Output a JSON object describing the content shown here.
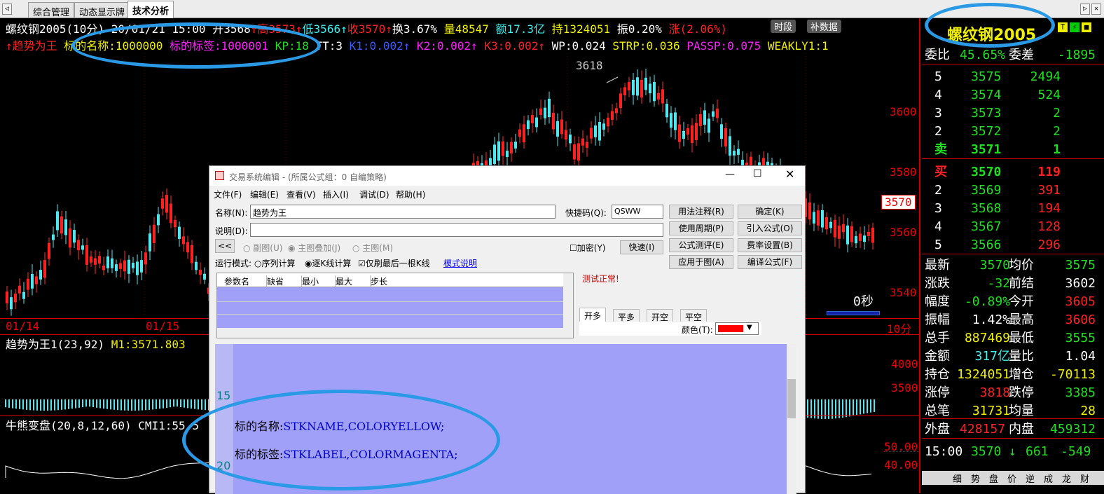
{
  "tabs": {
    "nav_left": "◁",
    "t1": "综合管理",
    "t2": "动态显示牌",
    "t3": "技术分析",
    "nav_right": "▷",
    "close": "✕"
  },
  "header": {
    "line1": [
      {
        "t": "螺纹钢2005(10分) 20/01/21 15:00 开3568",
        "c": "white"
      },
      {
        "t": "↑高3573↑",
        "c": "red"
      },
      {
        "t": "低3566↑",
        "c": "cyan"
      },
      {
        "t": "收3570↑",
        "c": "red"
      },
      {
        "t": "换3.67% ",
        "c": "white"
      },
      {
        "t": "量48547 ",
        "c": "yellow"
      },
      {
        "t": "额17.3亿 ",
        "c": "cyan"
      },
      {
        "t": "持1324051 ",
        "c": "yellow"
      },
      {
        "t": "振0.20% ",
        "c": "white"
      },
      {
        "t": "涨(2.06%)",
        "c": "red"
      }
    ],
    "badge1": "时段",
    "badge2": "补数据",
    "line2": [
      {
        "t": "↑趋势为王 ",
        "c": "red"
      },
      {
        "t": "标的名称:1000000 ",
        "c": "yellow"
      },
      {
        "t": "标的标签:1000001 ",
        "c": "mag"
      },
      {
        "t": "KP:18 ",
        "c": "green"
      },
      {
        "t": "TT:3 ",
        "c": "white"
      },
      {
        "t": "K1:0.002↑ ",
        "c": "blue"
      },
      {
        "t": "K2:0.002↑ ",
        "c": "mag"
      },
      {
        "t": "K3:0.002↑ ",
        "c": "red"
      },
      {
        "t": "WP:0.024 ",
        "c": "white"
      },
      {
        "t": "STRP:0.036 ",
        "c": "yellow"
      },
      {
        "t": "PASSP:0.075 ",
        "c": "mag"
      },
      {
        "t": "WEAKLY1:1",
        "c": "yellow"
      }
    ]
  },
  "chart": {
    "peak_label": "3618",
    "y_ticks": [
      "3600",
      "3580",
      "3560",
      "3540"
    ],
    "price_flag": "3570",
    "x_labels": [
      "01/14",
      "01/15"
    ],
    "timer": "0秒",
    "period": "10分",
    "ind1_title": "趋势为王1(23,92)",
    "ind1_val": "M1:3571.803",
    "ind1_ticks": [
      "4000",
      "3500"
    ],
    "ind2_title": "牛熊变盘(20,8,12,60)",
    "ind2_val": "CMI1:55.5",
    "ind2_ticks": [
      "50.00",
      "40.00"
    ]
  },
  "right": {
    "title": "螺纹钢2005",
    "weibi_l": "委比",
    "weibi_v": "45.65%",
    "weicha_l": "委差",
    "weicha_v": "-1895",
    "asks": [
      {
        "n": "5",
        "p": "3575",
        "v": "2494"
      },
      {
        "n": "4",
        "p": "3574",
        "v": "524"
      },
      {
        "n": "3",
        "p": "3573",
        "v": "2"
      },
      {
        "n": "2",
        "p": "3572",
        "v": "2"
      },
      {
        "n": "卖",
        "p": "3571",
        "v": "1"
      }
    ],
    "bids": [
      {
        "n": "买",
        "p": "3570",
        "v": "119"
      },
      {
        "n": "2",
        "p": "3569",
        "v": "391"
      },
      {
        "n": "3",
        "p": "3568",
        "v": "194"
      },
      {
        "n": "4",
        "p": "3567",
        "v": "128"
      },
      {
        "n": "5",
        "p": "3566",
        "v": "296"
      }
    ],
    "stats": [
      {
        "l1": "最新",
        "v1": "3570",
        "c1": "green",
        "l2": "均价",
        "v2": "3575",
        "c2": "green"
      },
      {
        "l1": "涨跌",
        "v1": "-32",
        "c1": "green",
        "l2": "前结",
        "v2": "3602",
        "c2": "white"
      },
      {
        "l1": "幅度",
        "v1": "-0.89%",
        "c1": "green",
        "l2": "今开",
        "v2": "3605",
        "c2": "red"
      },
      {
        "l1": "振幅",
        "v1": "1.42%",
        "c1": "white",
        "l2": "最高",
        "v2": "3606",
        "c2": "red"
      },
      {
        "l1": "总手",
        "v1": "887469",
        "c1": "yellow",
        "l2": "最低",
        "v2": "3555",
        "c2": "green"
      },
      {
        "l1": "金额",
        "v1": "317亿",
        "c1": "cyan",
        "l2": "量比",
        "v2": "1.04",
        "c2": "white"
      },
      {
        "l1": "持仓",
        "v1": "1324051",
        "c1": "yellow",
        "l2": "增仓",
        "v2": "-70113",
        "c2": "yellow"
      },
      {
        "l1": "涨停",
        "v1": "3818",
        "c1": "red",
        "l2": "跌停",
        "v2": "3385",
        "c2": "green"
      },
      {
        "l1": "总笔",
        "v1": "31731",
        "c1": "yellow",
        "l2": "均量",
        "v2": "28",
        "c2": "yellow"
      }
    ],
    "waipan_l": "外盘",
    "waipan_v": "428157",
    "neipan_l": "内盘",
    "neipan_v": "459312",
    "tick_time": "15:00",
    "tick_price": "3570",
    "tick_arrow": "↓",
    "tick_vol": "661",
    "tick_chg": "-549",
    "bottom_tabs": [
      "细",
      "势",
      "盘",
      "价",
      "逆",
      "成",
      "龙",
      "财"
    ]
  },
  "dialog": {
    "title": "交易系统编辑 - (所属公式组：0 自编策略)",
    "menu": [
      "文件(F)",
      "编辑(E)",
      "查看(V)",
      "插入(I)",
      "调试(D)",
      "帮助(H)"
    ],
    "name_label": "名称(N):",
    "name_value": "趋势为王",
    "hotkey_label": "快捷码(Q):",
    "hotkey_value": "QSWW",
    "desc_label": "说明(D):",
    "desc_value": "",
    "collapse": "<<",
    "radio_sub": "副图(U)",
    "radio_overlay": "主图叠加(J)",
    "radio_main": "主图(M)",
    "encrypt": "加密(Y)",
    "fast": "快速(I)",
    "mode_label": "运行模式:",
    "mode_seq": "序列计算",
    "mode_bar": "逐K线计算",
    "mode_last": "仅刷最后一根K线",
    "mode_help": "模式说明",
    "params_headers": [
      "参数名",
      "缺省",
      "最小",
      "最大",
      "步长"
    ],
    "status": "测试正常!",
    "tabs": [
      "开多",
      "平多",
      "开空",
      "平空"
    ],
    "color_label": "颜色(T):",
    "buttons": {
      "usage": "用法注释(R)",
      "ok": "确定(K)",
      "period": "使用周期(P)",
      "import": "引入公式(O)",
      "test": "公式测评(E)",
      "fee": "费率设置(B)",
      "apply": "应用于图(A)",
      "compile": "编译公式(F)"
    },
    "code": {
      "ln15": "15",
      "ln20": "20",
      "l1a": "标的名称:",
      "l1b": "STKNAME,COLORYELLOW;",
      "l2a": "标的标签:",
      "l2b": "STKLABEL,COLORMAGENTA;"
    }
  }
}
